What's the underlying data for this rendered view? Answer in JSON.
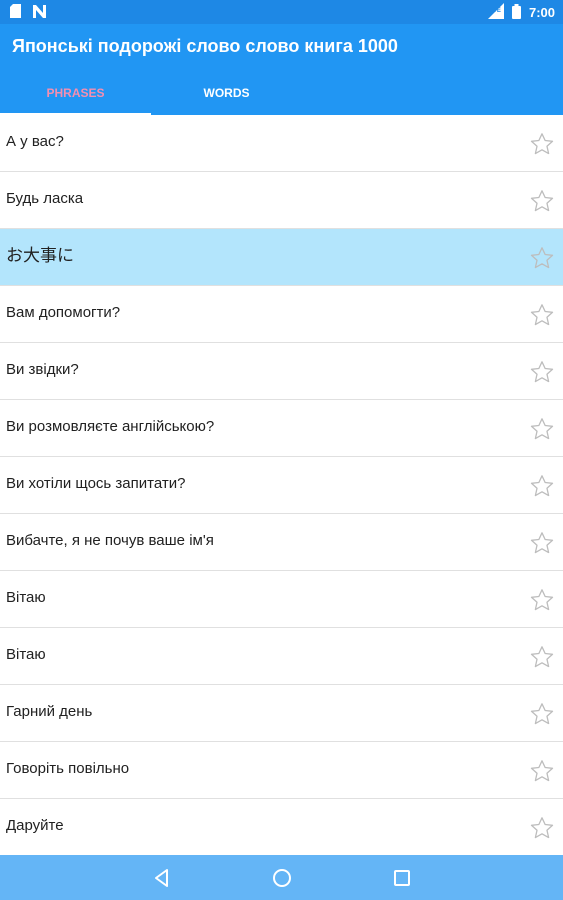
{
  "status_bar": {
    "time": "7:00",
    "icons": [
      "sd-card-icon",
      "n-notification-icon",
      "signal-icon",
      "battery-icon"
    ]
  },
  "app_bar": {
    "title": "Японські подорожі слово слово книга 1000",
    "tabs": [
      {
        "label": "PHRASES",
        "selected": true
      },
      {
        "label": "WORDS",
        "selected": false
      }
    ]
  },
  "colors": {
    "status_bar": "#1e88e5",
    "app_bar": "#2196f3",
    "selected_tab_text": "#f48fb1",
    "highlight_row": "#b3e5fc",
    "nav_bar": "#64b5f6"
  },
  "phrases": [
    {
      "text": "А у вас?",
      "highlighted": false
    },
    {
      "text": "Будь ласка",
      "highlighted": false
    },
    {
      "text": "お大事に",
      "highlighted": true
    },
    {
      "text": "Вам допомогти?",
      "highlighted": false
    },
    {
      "text": "Ви звідки?",
      "highlighted": false
    },
    {
      "text": "Ви розмовляєте англійською?",
      "highlighted": false
    },
    {
      "text": "Ви хотіли щось запитати?",
      "highlighted": false
    },
    {
      "text": "Вибачте, я не почув ваше ім'я",
      "highlighted": false
    },
    {
      "text": "Вітаю",
      "highlighted": false
    },
    {
      "text": "Вітаю",
      "highlighted": false
    },
    {
      "text": "Гарний день",
      "highlighted": false
    },
    {
      "text": "Говоріть повільно",
      "highlighted": false
    },
    {
      "text": "Даруйте",
      "highlighted": false
    }
  ],
  "nav_bar": {
    "icons": [
      "back-icon",
      "home-icon",
      "recents-icon"
    ]
  }
}
